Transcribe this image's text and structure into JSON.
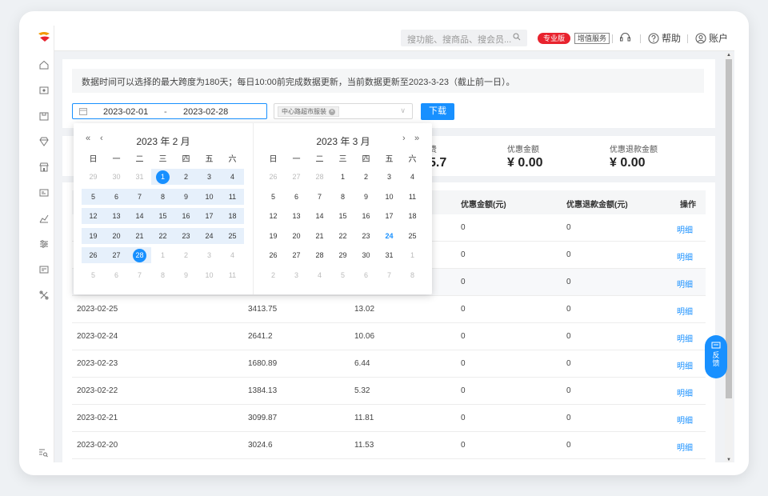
{
  "topbar": {
    "search_placeholder": "搜功能、搜商品、搜会员...",
    "badge_pro": "专业版",
    "badge_addon": "增值服务",
    "help_label": "帮助",
    "account_label": "账户"
  },
  "filters": {
    "notice": "数据时间可以选择的最大跨度为180天；每日10:00前完成数据更新，当前数据更新至2023-3-23（截止前一日）。",
    "start_date": "2023-02-01",
    "range_separator": "-",
    "end_date": "2023-02-28",
    "store_tag": "中心路超市服装",
    "download_label": "下载"
  },
  "stats": {
    "partial_value": "5.7",
    "discount_label": "优惠金额",
    "discount_value": "¥ 0.00",
    "refund_discount_label": "优惠退款金额",
    "refund_discount_value": "¥ 0.00",
    "partial_label": "费"
  },
  "table": {
    "headers": {
      "discount": "优惠金额(元)",
      "refund_discount": "优惠退款金额(元)",
      "action": "操作"
    },
    "partial_rows": [
      {
        "discount": "0",
        "refund": "0",
        "action": "明细"
      },
      {
        "discount": "0",
        "refund": "0",
        "action": "明细"
      },
      {
        "discount": "0",
        "refund": "0",
        "action": "明细"
      }
    ],
    "rows": [
      {
        "date": "2023-02-25",
        "amount": "3413.75",
        "fee": "13.02",
        "discount": "0",
        "refund": "0",
        "action": "明细"
      },
      {
        "date": "2023-02-24",
        "amount": "2641.2",
        "fee": "10.06",
        "discount": "0",
        "refund": "0",
        "action": "明细"
      },
      {
        "date": "2023-02-23",
        "amount": "1680.89",
        "fee": "6.44",
        "discount": "0",
        "refund": "0",
        "action": "明细"
      },
      {
        "date": "2023-02-22",
        "amount": "1384.13",
        "fee": "5.32",
        "discount": "0",
        "refund": "0",
        "action": "明细"
      },
      {
        "date": "2023-02-21",
        "amount": "3099.87",
        "fee": "11.81",
        "discount": "0",
        "refund": "0",
        "action": "明细"
      },
      {
        "date": "2023-02-20",
        "amount": "3024.6",
        "fee": "11.53",
        "discount": "0",
        "refund": "0",
        "action": "明细"
      }
    ]
  },
  "feedback": {
    "line1": "反",
    "line2": "馈"
  },
  "datepicker": {
    "weekdays": [
      "日",
      "一",
      "二",
      "三",
      "四",
      "五",
      "六"
    ],
    "left": {
      "title": "2023 年 2 月",
      "prev_year": "«",
      "prev_month": "‹",
      "days": [
        {
          "d": "29",
          "t": "gray"
        },
        {
          "d": "30",
          "t": "gray"
        },
        {
          "d": "31",
          "t": "gray"
        },
        {
          "d": "1",
          "t": "start"
        },
        {
          "d": "2",
          "t": "in"
        },
        {
          "d": "3",
          "t": "in"
        },
        {
          "d": "4",
          "t": "in"
        },
        {
          "d": "5",
          "t": "in"
        },
        {
          "d": "6",
          "t": "in"
        },
        {
          "d": "7",
          "t": "in"
        },
        {
          "d": "8",
          "t": "in"
        },
        {
          "d": "9",
          "t": "in"
        },
        {
          "d": "10",
          "t": "in"
        },
        {
          "d": "11",
          "t": "in"
        },
        {
          "d": "12",
          "t": "in"
        },
        {
          "d": "13",
          "t": "in"
        },
        {
          "d": "14",
          "t": "in"
        },
        {
          "d": "15",
          "t": "in"
        },
        {
          "d": "16",
          "t": "in"
        },
        {
          "d": "17",
          "t": "in"
        },
        {
          "d": "18",
          "t": "in"
        },
        {
          "d": "19",
          "t": "in"
        },
        {
          "d": "20",
          "t": "in"
        },
        {
          "d": "21",
          "t": "in"
        },
        {
          "d": "22",
          "t": "in"
        },
        {
          "d": "23",
          "t": "in"
        },
        {
          "d": "24",
          "t": "in"
        },
        {
          "d": "25",
          "t": "in"
        },
        {
          "d": "26",
          "t": "in"
        },
        {
          "d": "27",
          "t": "in"
        },
        {
          "d": "28",
          "t": "end"
        },
        {
          "d": "1",
          "t": "gray"
        },
        {
          "d": "2",
          "t": "gray"
        },
        {
          "d": "3",
          "t": "gray"
        },
        {
          "d": "4",
          "t": "gray"
        },
        {
          "d": "5",
          "t": "gray"
        },
        {
          "d": "6",
          "t": "gray"
        },
        {
          "d": "7",
          "t": "gray"
        },
        {
          "d": "8",
          "t": "gray"
        },
        {
          "d": "9",
          "t": "gray"
        },
        {
          "d": "10",
          "t": "gray"
        },
        {
          "d": "11",
          "t": "gray"
        }
      ]
    },
    "right": {
      "title": "2023 年 3 月",
      "next_month": "›",
      "next_year": "»",
      "days": [
        {
          "d": "26",
          "t": "gray"
        },
        {
          "d": "27",
          "t": "gray"
        },
        {
          "d": "28",
          "t": "gray"
        },
        {
          "d": "1",
          "t": "n"
        },
        {
          "d": "2",
          "t": "n"
        },
        {
          "d": "3",
          "t": "n"
        },
        {
          "d": "4",
          "t": "n"
        },
        {
          "d": "5",
          "t": "n"
        },
        {
          "d": "6",
          "t": "n"
        },
        {
          "d": "7",
          "t": "n"
        },
        {
          "d": "8",
          "t": "n"
        },
        {
          "d": "9",
          "t": "n"
        },
        {
          "d": "10",
          "t": "n"
        },
        {
          "d": "11",
          "t": "n"
        },
        {
          "d": "12",
          "t": "n"
        },
        {
          "d": "13",
          "t": "n"
        },
        {
          "d": "14",
          "t": "n"
        },
        {
          "d": "15",
          "t": "n"
        },
        {
          "d": "16",
          "t": "n"
        },
        {
          "d": "17",
          "t": "n"
        },
        {
          "d": "18",
          "t": "n"
        },
        {
          "d": "19",
          "t": "n"
        },
        {
          "d": "20",
          "t": "n"
        },
        {
          "d": "21",
          "t": "n"
        },
        {
          "d": "22",
          "t": "n"
        },
        {
          "d": "23",
          "t": "n"
        },
        {
          "d": "24",
          "t": "today"
        },
        {
          "d": "25",
          "t": "n"
        },
        {
          "d": "26",
          "t": "n"
        },
        {
          "d": "27",
          "t": "n"
        },
        {
          "d": "28",
          "t": "n"
        },
        {
          "d": "29",
          "t": "n"
        },
        {
          "d": "30",
          "t": "n"
        },
        {
          "d": "31",
          "t": "n"
        },
        {
          "d": "1",
          "t": "gray"
        },
        {
          "d": "2",
          "t": "gray"
        },
        {
          "d": "3",
          "t": "gray"
        },
        {
          "d": "4",
          "t": "gray"
        },
        {
          "d": "5",
          "t": "gray"
        },
        {
          "d": "6",
          "t": "gray"
        },
        {
          "d": "7",
          "t": "gray"
        },
        {
          "d": "8",
          "t": "gray"
        }
      ]
    }
  },
  "colors": {
    "accent": "#1890ff",
    "pro_badge": "#e8232e"
  },
  "icons": [
    "logo-icon",
    "home-icon",
    "cashier-icon",
    "goods-icon",
    "member-icon",
    "store-icon",
    "card-icon",
    "chart-icon",
    "settings-icon",
    "message-icon",
    "apps-icon",
    "search-list-icon",
    "headset-icon",
    "help-icon",
    "user-icon",
    "calendar-icon",
    "search-icon"
  ]
}
